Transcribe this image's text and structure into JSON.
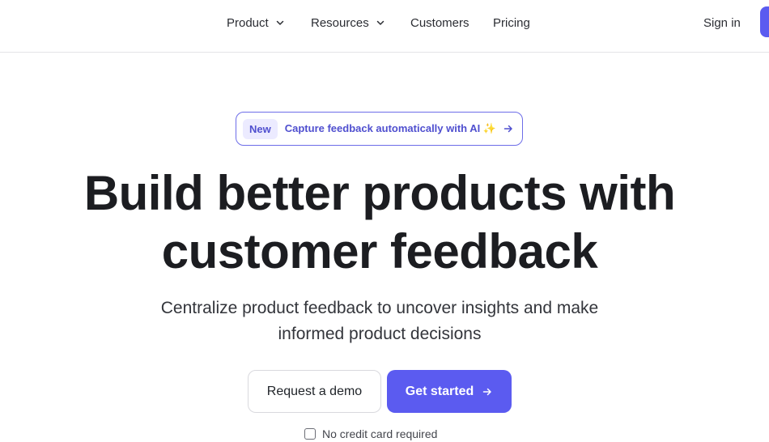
{
  "nav": {
    "product": "Product",
    "resources": "Resources",
    "customers": "Customers",
    "pricing": "Pricing",
    "sign_in": "Sign in"
  },
  "badge": {
    "pill": "New",
    "text": "Capture feedback automatically with AI ✨"
  },
  "hero": {
    "headline_line1": "Build better products with",
    "headline_line2": "customer feedback",
    "subhead_line1": "Centralize product feedback to uncover insights and make",
    "subhead_line2": "informed product decisions"
  },
  "actions": {
    "request_demo": "Request a demo",
    "get_started": "Get started"
  },
  "footnote": {
    "no_credit_card": "No credit card required"
  },
  "colors": {
    "accent": "#5b5bf0",
    "badge_border": "#6d6de8",
    "badge_text": "#4f4fcf"
  },
  "icons": {
    "product_chevron": "chevron-down-icon",
    "resources_chevron": "chevron-down-icon",
    "badge_arrow": "arrow-right-icon",
    "button_arrow": "arrow-right-icon",
    "footnote_icon": "card-icon"
  }
}
